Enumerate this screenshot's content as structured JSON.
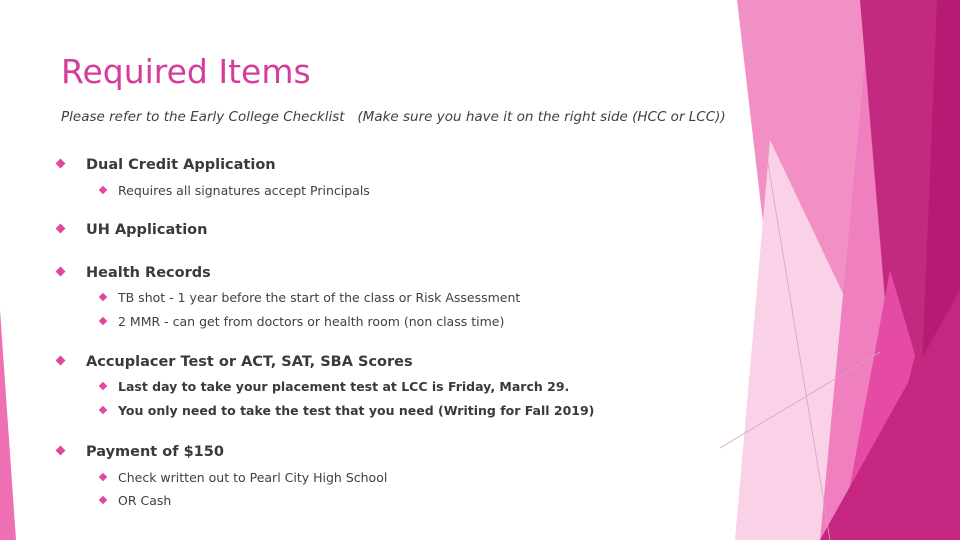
{
  "slide": {
    "title": "Required Items",
    "subtitle": "Please refer to the Early College Checklist   (Make sure you have it on the right side (HCC or LCC))",
    "bullet_icon": "diamond-bullet",
    "colors": {
      "title": "#d63d9b",
      "bullet": "#e0489e",
      "text": "#404040",
      "accent_dark": "#bd1e78",
      "accent_mid": "#ef7fbf",
      "accent_light": "#f7c8e2"
    },
    "items": [
      {
        "label": "Dual Credit Application",
        "children": [
          "Requires all signatures accept Principals"
        ]
      },
      {
        "label": "UH Application",
        "children": []
      },
      {
        "label": "Health Records",
        "children": [
          "TB shot - 1 year before the start of the class or Risk Assessment",
          "2 MMR - can get from doctors or health room (non class time)"
        ]
      },
      {
        "label": "Accuplacer Test or ACT, SAT, SBA Scores",
        "children": [
          "Last day to take your placement test at LCC is Friday, March 29.",
          "You only need to take the test that you need (Writing for Fall 2019)"
        ]
      },
      {
        "label": "Payment of $150",
        "children": [
          "Check written out to Pearl City High School",
          "OR Cash"
        ]
      }
    ]
  }
}
